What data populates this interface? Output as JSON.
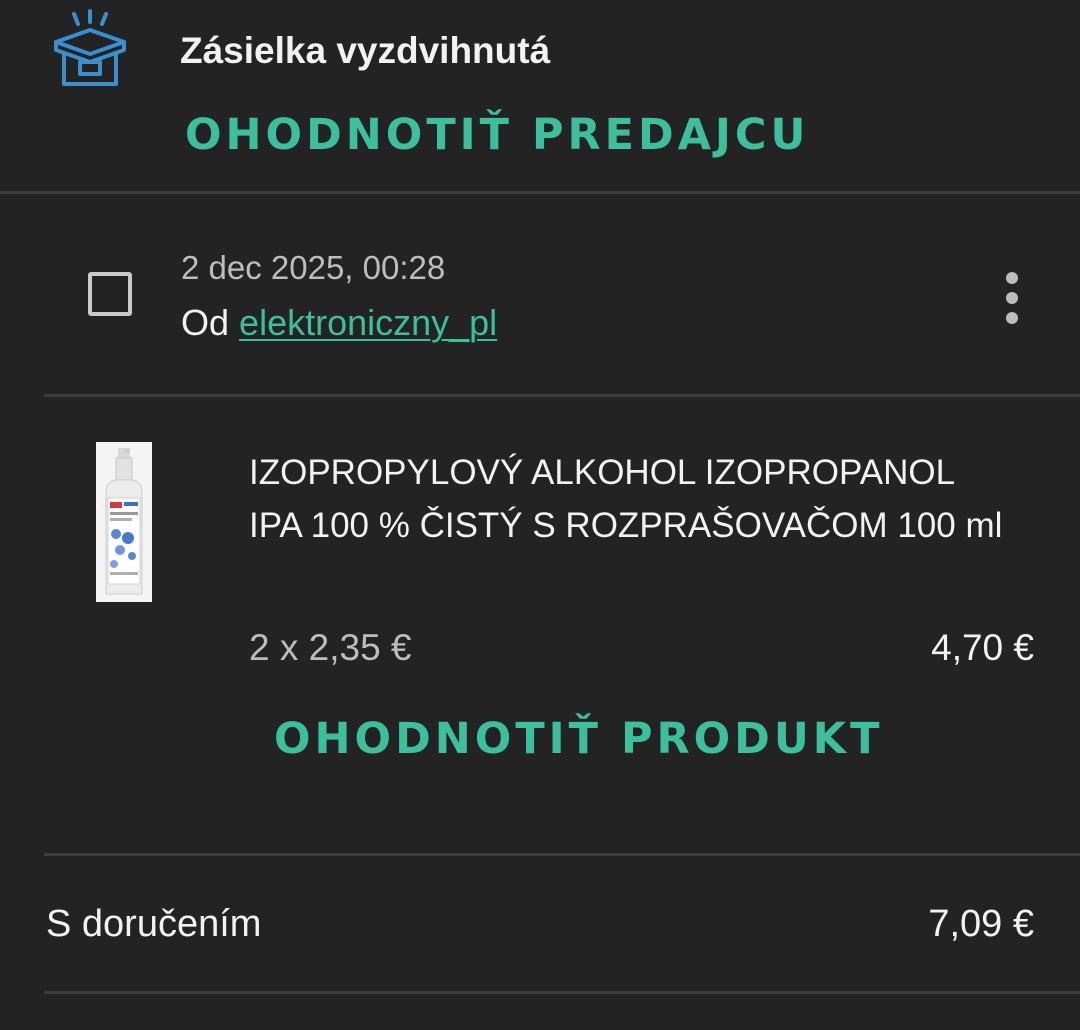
{
  "shipment": {
    "status": "Zásielka vyzdvihnutá",
    "icon": "package-open-icon",
    "rate_seller_label": "OHODNOTIŤ PREDAJCU"
  },
  "order": {
    "date": "2 dec 2025, 00:28",
    "seller_prefix": "Od",
    "seller_name": "elektroniczny_pl"
  },
  "item": {
    "title": "IZOPROPYLOVÝ ALKOHOL IZOPROPANOL IPA 100 % ČISTÝ S ROZPRAŠOVAČOM 100 ml",
    "quantity_price": "2 x 2,35 €",
    "total": "4,70 €",
    "rate_product_label": "OHODNOTIŤ PRODUKT"
  },
  "summary": {
    "label": "S doručením",
    "total": "7,09 €"
  },
  "colors": {
    "background": "#232323",
    "accent": "#3cbf9c",
    "icon_blue": "#3a8fd0"
  }
}
